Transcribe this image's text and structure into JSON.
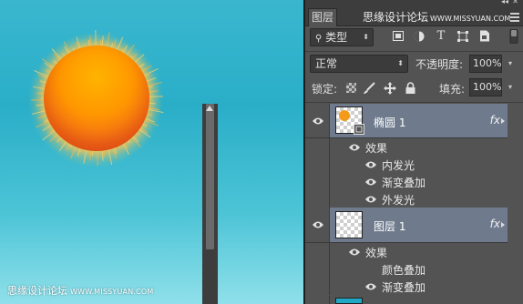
{
  "canvas": {
    "watermark": "思缘设计论坛",
    "watermark_url": "WWW.MISSYUAN.COM"
  },
  "panel": {
    "tab_label": "图层",
    "header_watermark": "思缘设计论坛",
    "header_watermark_url": "WWW.MISSYUAN.COM",
    "filter": {
      "icon": "search-icon",
      "kind": "类型"
    },
    "blend_mode": "正常",
    "opacity_label": "不透明度:",
    "opacity_value": "100%",
    "lock_label": "锁定:",
    "fill_label": "填充:",
    "fill_value": "100%",
    "filter_icons": [
      "image-icon",
      "adjustment-icon",
      "type-icon",
      "shape-icon",
      "smartobject-icon"
    ],
    "lock_icons": [
      "lock-transparent-icon",
      "lock-brush-icon",
      "lock-move-icon",
      "lock-all-icon"
    ]
  },
  "layers": [
    {
      "name": "椭圆 1",
      "fx": "fx",
      "effects_label": "效果",
      "effects": [
        "内发光",
        "渐变叠加",
        "外发光"
      ]
    },
    {
      "name": "图层 1",
      "fx": "fx",
      "effects_label": "效果",
      "effects": [
        "颜色叠加",
        "渐变叠加"
      ]
    }
  ],
  "colors": {
    "selected_layer": "#6f7b8d",
    "panel_bg": "#535353",
    "canvas_top": "#2aaec8",
    "sun": "#ff9800"
  }
}
